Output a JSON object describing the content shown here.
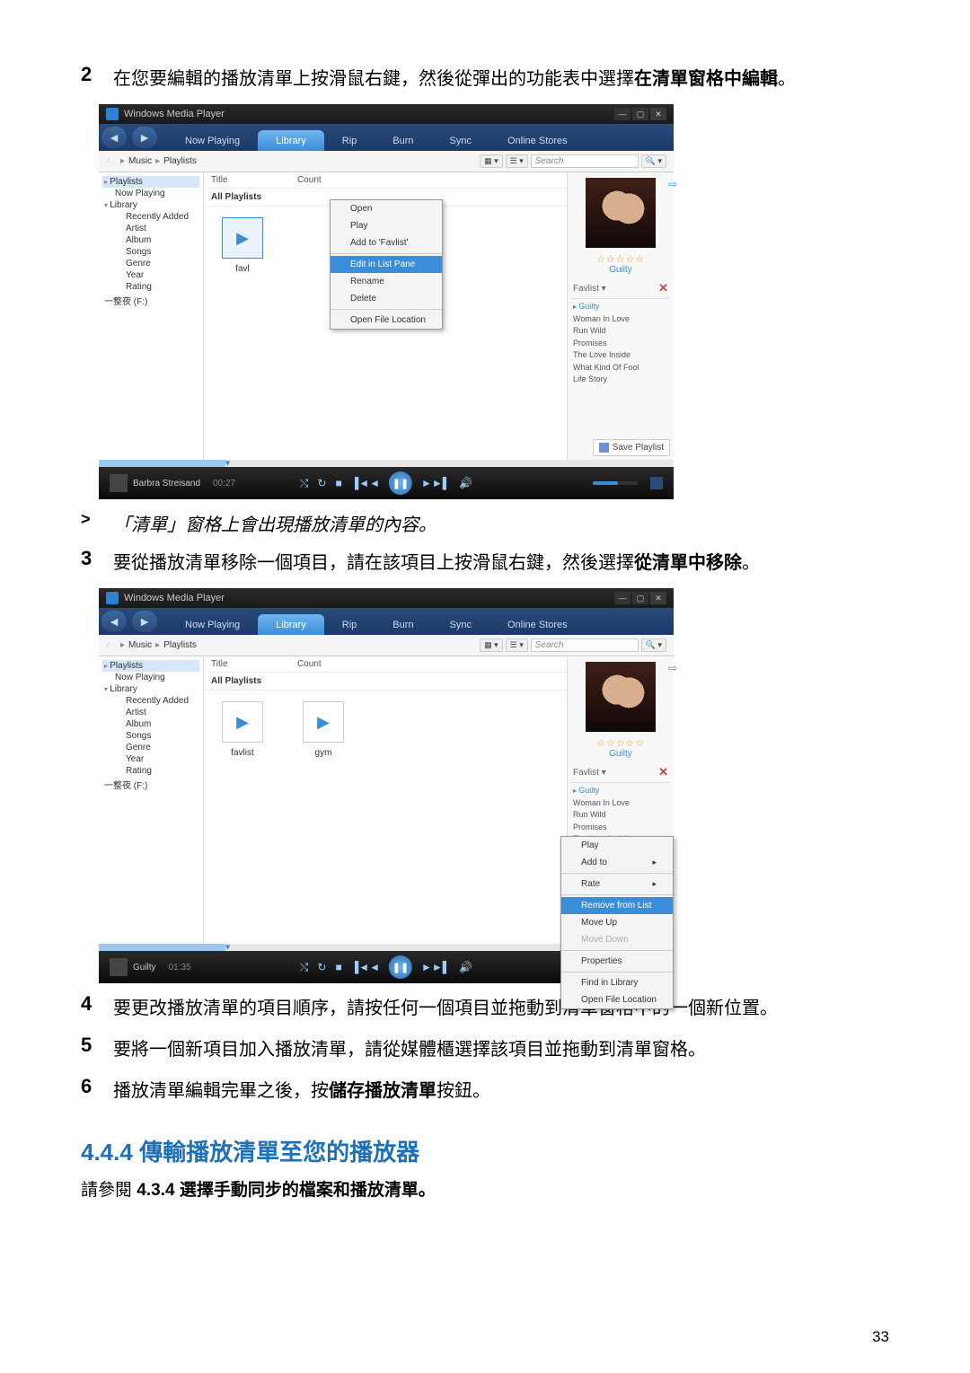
{
  "steps": {
    "s2": {
      "num": "2",
      "pre": "在您要編輯的播放清單上按滑鼠右鍵，然後從彈出的功能表中選擇",
      "bold": "在清單窗格中編輯",
      "post": "。"
    },
    "note": {
      "sym": ">",
      "text": "「清單」窗格上會出現播放清單的內容。"
    },
    "s3": {
      "num": "3",
      "pre": "要從播放清單移除一個項目，請在該項目上按滑鼠右鍵，然後選擇",
      "bold": "從清單中移除",
      "post": "。"
    },
    "s4": {
      "num": "4",
      "text": "要更改播放清單的項目順序，請按任何一個項目並拖動到清單窗格中的一個新位置。"
    },
    "s5": {
      "num": "5",
      "text": "要將一個新項目加入播放清單，請從媒體櫃選擇該項目並拖動到清單窗格。"
    },
    "s6": {
      "num": "6",
      "pre": "播放清單編輯完畢之後，按",
      "bold": "儲存播放清單",
      "post": "按鈕。"
    }
  },
  "section": {
    "num": "4.4.4",
    "title": "傳輸播放清單至您的播放器"
  },
  "ref": {
    "pre": "請參閱 ",
    "bold": "4.3.4 選擇手動同步的檔案和播放清單。"
  },
  "pagenum": "33",
  "wmp": {
    "title": "Windows Media Player",
    "tabs": [
      "Now Playing",
      "Library",
      "Rip",
      "Burn",
      "Sync",
      "Online Stores"
    ],
    "selectedTab": "Library",
    "breadcrumb": [
      "Music",
      "Playlists"
    ],
    "searchPlaceholder": "Search",
    "columns": {
      "title": "Title",
      "count": "Count"
    },
    "allPlaylists": "All Playlists",
    "tree": {
      "playlists": "Playlists",
      "nowPlaying": "Now Playing",
      "library": "Library",
      "items": [
        "Recently Added",
        "Artist",
        "Album",
        "Songs",
        "Genre",
        "Year",
        "Rating"
      ],
      "drive": "一整夜 (F:)"
    },
    "ctx1": [
      "Open",
      "Play",
      "Add to 'Favlist'",
      "Edit in List Pane",
      "Rename",
      "Delete",
      "Open File Location"
    ],
    "ctx1_hl": "Edit in List Pane",
    "playlistIcons": {
      "favlist_sel": "favl",
      "favlist": "favlist",
      "gym": "gym"
    },
    "right": {
      "stars": "☆☆☆☆☆",
      "artTitle": "Guilty",
      "listName": "Favlist",
      "tracks": [
        "Guilty",
        "Woman In Love",
        "Run Wild",
        "Promises",
        "The Love Inside",
        "What Kind Of Fool",
        "Life Story"
      ]
    },
    "ctx2": [
      "Play",
      "Add to",
      "Rate",
      "Remove from List",
      "Move Up",
      "Move Down",
      "Properties",
      "Find in Library",
      "Open File Location"
    ],
    "ctx2_hl": "Remove from List",
    "ctx2_sel": "Life Story",
    "save": "Save Playlist",
    "np1": {
      "title": "Barbra Streisand",
      "time": "00:27"
    },
    "np2": {
      "title": "Guilty",
      "time": "01:35"
    }
  }
}
